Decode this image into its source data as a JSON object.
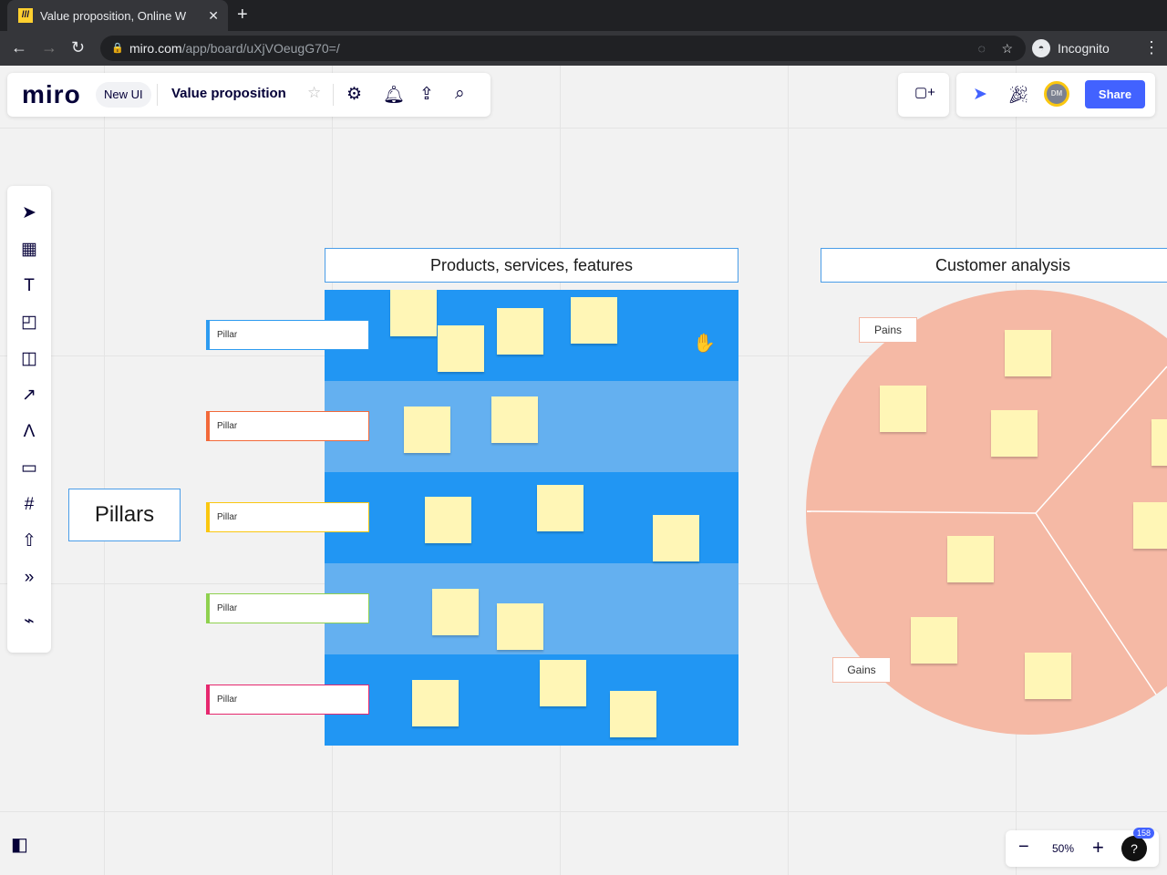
{
  "browser": {
    "tab_title": "Value proposition, Online W",
    "url_host": "miro.com",
    "url_path": "/app/board/uXjVOeugG70=/",
    "profile": "Incognito"
  },
  "header": {
    "logo": "miro",
    "new_ui": "New UI",
    "board_name": "Value proposition",
    "share": "Share",
    "avatar_initials": "DM"
  },
  "board": {
    "frame1_title": "Products, services, features",
    "frame2_title": "Customer analysis",
    "pillars_title": "Pillars",
    "pillars": [
      {
        "label": "Pillar",
        "color": "#2d9bf0"
      },
      {
        "label": "Pillar",
        "color": "#f2693a"
      },
      {
        "label": "Pillar",
        "color": "#fac710"
      },
      {
        "label": "Pillar",
        "color": "#8fd14f"
      },
      {
        "label": "Pillar",
        "color": "#e6286e"
      }
    ],
    "pains": "Pains",
    "gains": "Gains"
  },
  "zoom": {
    "level": "50%",
    "notifications": "158"
  }
}
